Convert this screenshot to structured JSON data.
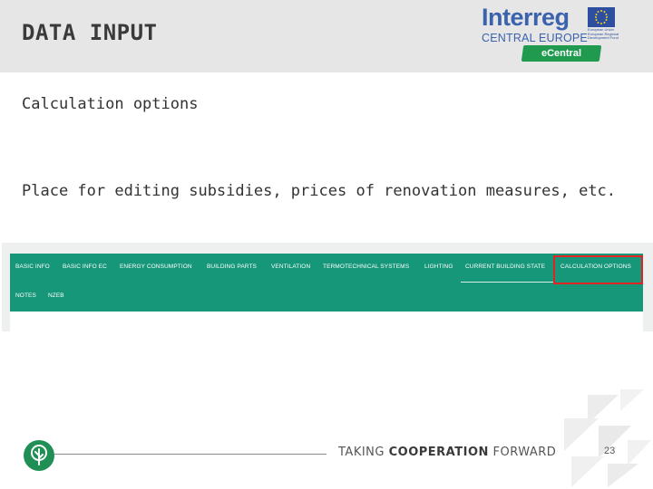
{
  "slide": {
    "title": "DATA INPUT",
    "subtitle": "Calculation options",
    "description": "Place for editing subsidies, prices of renovation measures, etc."
  },
  "logo": {
    "word": "Interreg",
    "sub": "CENTRAL EUROPE",
    "eu_text": "European Union European Regional Development Fund",
    "tag": "eCentral",
    "colors": {
      "word": "#3b62ad",
      "tag": "#1f9a4f"
    }
  },
  "tabs": {
    "items": [
      {
        "label": "BASIC INFO"
      },
      {
        "label": "BASIC INFO EC"
      },
      {
        "label": "ENERGY CONSUMPTION"
      },
      {
        "label": "BUILDING PARTS"
      },
      {
        "label": "VENTILATION"
      },
      {
        "label": "TERMOTECHNICAL SYSTEMS"
      },
      {
        "label": "LIGHTING"
      },
      {
        "label": "CURRENT BUILDING STATE"
      },
      {
        "label": "CALCULATION OPTIONS"
      },
      {
        "label": "NOTES"
      },
      {
        "label": "NZEB"
      }
    ],
    "underlined": "CURRENT BUILDING STATE",
    "highlighted": "CALCULATION OPTIONS",
    "colors": {
      "bar": "#16977a",
      "highlight": "#e02424"
    }
  },
  "footer": {
    "tagline_pre": "TAKING ",
    "tagline_bold": "COOPERATION",
    "tagline_post": " FORWARD",
    "page_number": "23",
    "icon": "tree-icon"
  }
}
